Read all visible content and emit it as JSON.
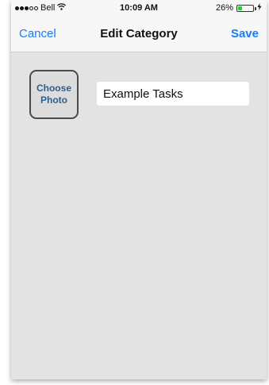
{
  "status_bar": {
    "carrier": "Bell",
    "time": "10:09 AM",
    "battery_percent_text": "26%",
    "battery_level": 0.26,
    "signal_bars_filled": 3,
    "signal_bars_total": 5
  },
  "nav": {
    "cancel_label": "Cancel",
    "title": "Edit Category",
    "save_label": "Save"
  },
  "form": {
    "photo_button_line1": "Choose",
    "photo_button_line2": "Photo",
    "category_name_value": "Example Tasks"
  },
  "colors": {
    "accent": "#1a7cf5",
    "background": "#e3e3e3",
    "photo_text": "#2f5d8c",
    "battery": "#2ecc40"
  }
}
